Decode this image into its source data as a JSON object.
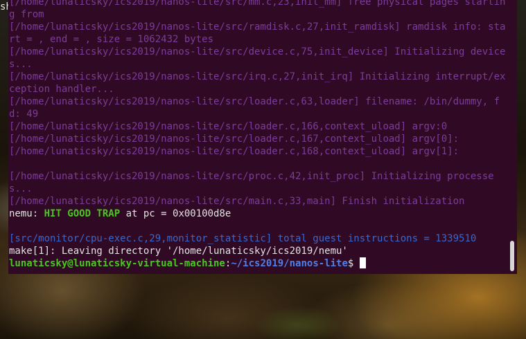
{
  "desktop": {
    "label": "sh"
  },
  "terminal": {
    "lines": [
      {
        "text": "[/home/lunaticsky/ics2019/nanos-lite/src/mm.c,23,init_mm] free physical pages starting from"
      },
      {
        "text": "[/home/lunaticsky/ics2019/nanos-lite/src/ramdisk.c,27,init_ramdisk] ramdisk info: start = , end = , size = 1062432 bytes"
      },
      {
        "text": "[/home/lunaticsky/ics2019/nanos-lite/src/device.c,75,init_device] Initializing devices..."
      },
      {
        "text": "[/home/lunaticsky/ics2019/nanos-lite/src/irq.c,27,init_irq] Initializing interrupt/exception handler..."
      },
      {
        "text": "[/home/lunaticsky/ics2019/nanos-lite/src/loader.c,63,loader] filename: /bin/dummy, fd: 49"
      },
      {
        "text": "[/home/lunaticsky/ics2019/nanos-lite/src/loader.c,166,context_uload] argv:0"
      },
      {
        "text": "[/home/lunaticsky/ics2019/nanos-lite/src/loader.c,167,context_uload] argv[0]:"
      },
      {
        "text": "[/home/lunaticsky/ics2019/nanos-lite/src/loader.c,168,context_uload] argv[1]:"
      },
      {
        "text": ""
      },
      {
        "text": "[/home/lunaticsky/ics2019/nanos-lite/src/proc.c,42,init_proc] Initializing processes..."
      },
      {
        "text": "[/home/lunaticsky/ics2019/nanos-lite/src/main.c,33,main] Finish initialization"
      }
    ],
    "nemu": {
      "prefix": "nemu: ",
      "status": "HIT GOOD TRAP",
      "suffix": " at pc = 0x00100d8e"
    },
    "blank": "",
    "statistic": "[src/monitor/cpu-exec.c,29,monitor_statistic] total guest instructions = 1339510",
    "make_line": "make[1]: Leaving directory '/home/lunaticsky/ics2019/nemu'",
    "prompt": {
      "user_host": "lunaticsky@lunaticsky-virtual-machine",
      "sep": ":",
      "path": "~/ics2019/nanos-lite",
      "symbol": "$ "
    },
    "colors": {
      "background": "#300a24",
      "log_text": "#7c3c9a",
      "statistic_text": "#3a67cc",
      "good_trap": "#4ac81f",
      "prompt_user": "#4ac81f",
      "prompt_path": "#4f7fe8"
    }
  }
}
